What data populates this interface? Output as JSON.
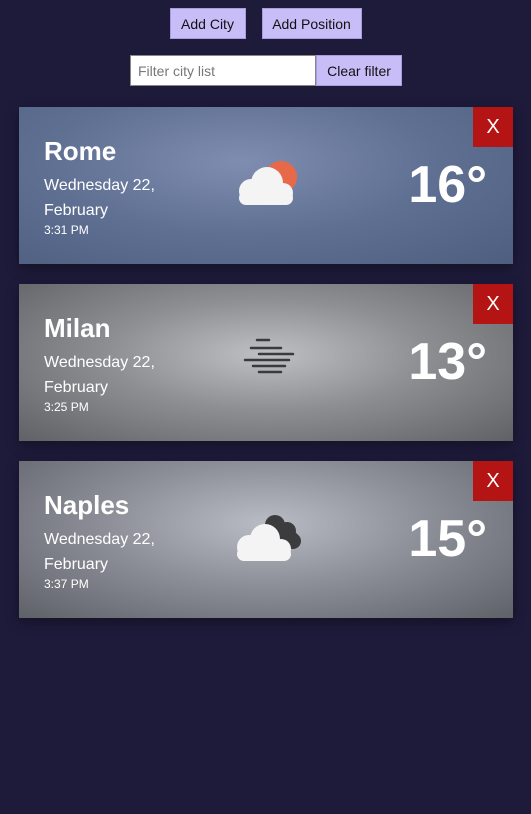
{
  "toolbar": {
    "add_city_label": "Add City",
    "add_position_label": "Add Position"
  },
  "filter": {
    "placeholder": "Filter city list",
    "value": "",
    "clear_label": "Clear filter"
  },
  "cards": [
    {
      "city": "Rome",
      "date": "Wednesday 22, February",
      "time": "3:31 PM",
      "temperature": "16°",
      "icon": "partly-cloudy-icon",
      "close_label": "X"
    },
    {
      "city": "Milan",
      "date": "Wednesday 22, February",
      "time": "3:25 PM",
      "temperature": "13°",
      "icon": "fog-icon",
      "close_label": "X"
    },
    {
      "city": "Naples",
      "date": "Wednesday 22, February",
      "time": "3:37 PM",
      "temperature": "15°",
      "icon": "cloudy-icon",
      "close_label": "X"
    }
  ],
  "colors": {
    "background": "#1e1a3a",
    "button": "#c9bdf8",
    "close_button": "#b51414"
  }
}
